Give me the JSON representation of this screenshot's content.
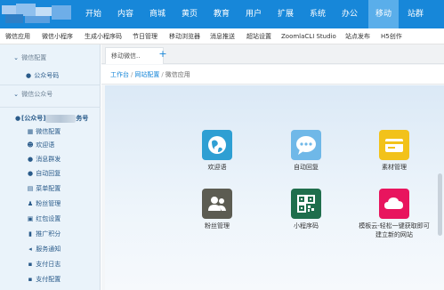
{
  "topnav": {
    "items": [
      "开始",
      "内容",
      "商城",
      "黄页",
      "教育",
      "用户",
      "扩展",
      "系统",
      "办公",
      "移动",
      "站群"
    ],
    "active_index": 9
  },
  "subnav": {
    "items": [
      "微信应用",
      "微信小程序",
      "生成小程序码",
      "节日管理",
      "移动浏览器",
      "消息推送",
      "超站设置",
      "ZoomlaCLI Studio",
      "站点发布",
      "H5创作"
    ]
  },
  "sidebar": {
    "section1": "微信配置",
    "public_account": "公众号码",
    "section2": "微信公众号",
    "account_prefix": "[公众号]",
    "account_suffix": "务号",
    "items": [
      {
        "label": "微信配置",
        "icon": "grid-icon"
      },
      {
        "label": "欢迎语",
        "icon": "user-icon"
      },
      {
        "label": "消息群发",
        "icon": "message-icon"
      },
      {
        "label": "自动回复",
        "icon": "reply-icon"
      },
      {
        "label": "菜单配置",
        "icon": "menu-icon"
      },
      {
        "label": "粉丝管理",
        "icon": "users-icon"
      },
      {
        "label": "红包设置",
        "icon": "gift-icon"
      },
      {
        "label": "推广积分",
        "icon": "chart-icon"
      },
      {
        "label": "服务通知",
        "icon": "bell-icon"
      },
      {
        "label": "支付日志",
        "icon": "log-icon"
      },
      {
        "label": "支付配置",
        "icon": "config-icon"
      }
    ]
  },
  "tabs": {
    "active_label": "移动微信..",
    "add_symbol": "+"
  },
  "breadcrumb": [
    "工作台",
    "网站配置",
    "微信应用"
  ],
  "apps": [
    {
      "label": "欢迎语",
      "color": "#2e9fd3",
      "icon": "globe-icon"
    },
    {
      "label": "自动回复",
      "color": "#6fb8e8",
      "icon": "chat-icon"
    },
    {
      "label": "素材管理",
      "color": "#f2c21a",
      "icon": "card-icon"
    },
    {
      "label": "粉丝管理",
      "color": "#5c5c52",
      "icon": "people-icon"
    },
    {
      "label": "小程序码",
      "color": "#1f6e4c",
      "icon": "qrcode-icon"
    },
    {
      "label": "模板云-轻松一键获取即可建立新的网站",
      "label_line1": "模板云-轻松一键获取即可",
      "label_line2": "建立新的网站",
      "color": "#e8155e",
      "icon": "cloud-icon"
    }
  ],
  "colors": {
    "brand": "#1787d9",
    "active_nav": "#5aaeea",
    "sidebar_bg": "#eaf3fa"
  }
}
